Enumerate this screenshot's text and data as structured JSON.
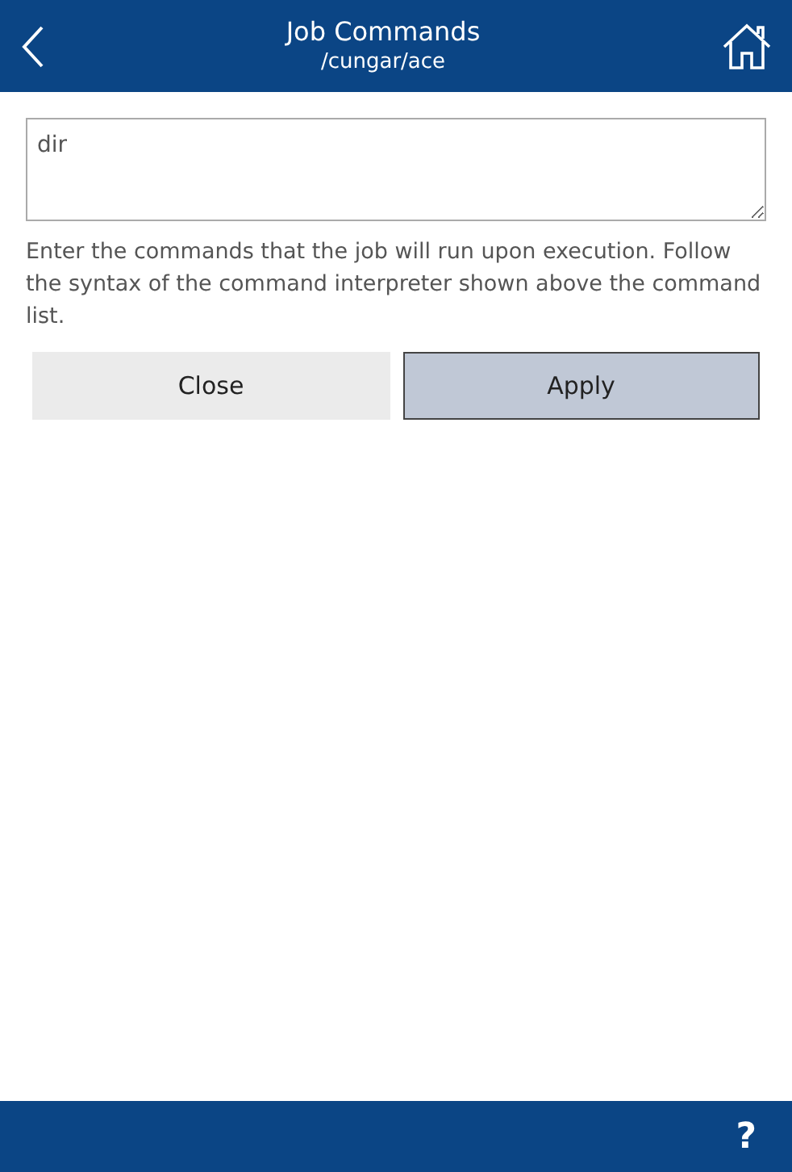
{
  "header": {
    "title": "Job Commands",
    "subtitle": "/cungar/ace"
  },
  "commands": {
    "value": "dir"
  },
  "help_text": "Enter the commands that the job will run upon execution. Follow the syntax of the command interpreter shown above the command list.",
  "buttons": [
    {
      "label": "Close",
      "kind": "secondary"
    },
    {
      "label": "Apply",
      "kind": "primary"
    }
  ],
  "footer": {
    "help": "?"
  }
}
